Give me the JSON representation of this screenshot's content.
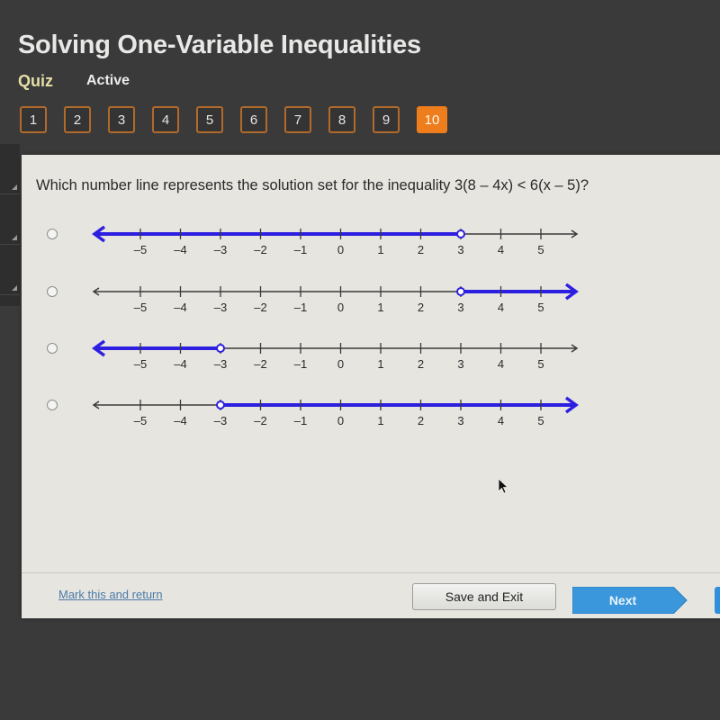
{
  "header": {
    "title": "Solving One-Variable Inequalities",
    "mode": "Quiz",
    "status": "Active"
  },
  "question_nav": {
    "items": [
      "1",
      "2",
      "3",
      "4",
      "5",
      "6",
      "7",
      "8",
      "9",
      "10"
    ],
    "current": "10"
  },
  "colors": {
    "accent_orange": "#ee7d1c",
    "highlight_blue": "#2d1fe0",
    "next_blue": "#3a97dc"
  },
  "question": {
    "text": "Which number line represents the solution set for the inequality 3(8 – 4x) < 6(x – 5)?",
    "options": [
      {
        "id": "a",
        "tick_labels": [
          "–5",
          "–4",
          "–3",
          "–2",
          "–1",
          "0",
          "1",
          "2",
          "3",
          "4",
          "5"
        ],
        "endpoint": 3,
        "endpoint_type": "open",
        "shaded_direction": "left"
      },
      {
        "id": "b",
        "tick_labels": [
          "–5",
          "–4",
          "–3",
          "–2",
          "–1",
          "0",
          "1",
          "2",
          "3",
          "4",
          "5"
        ],
        "endpoint": 3,
        "endpoint_type": "open",
        "shaded_direction": "right"
      },
      {
        "id": "c",
        "tick_labels": [
          "–5",
          "–4",
          "–3",
          "–2",
          "–1",
          "0",
          "1",
          "2",
          "3",
          "4",
          "5"
        ],
        "endpoint": -3,
        "endpoint_type": "open",
        "shaded_direction": "left"
      },
      {
        "id": "d",
        "tick_labels": [
          "–5",
          "–4",
          "–3",
          "–2",
          "–1",
          "0",
          "1",
          "2",
          "3",
          "4",
          "5"
        ],
        "endpoint": -3,
        "endpoint_type": "open",
        "shaded_direction": "right"
      }
    ]
  },
  "footer": {
    "mark_link": "Mark this and return",
    "save_label": "Save and Exit",
    "next_label": "Next"
  }
}
